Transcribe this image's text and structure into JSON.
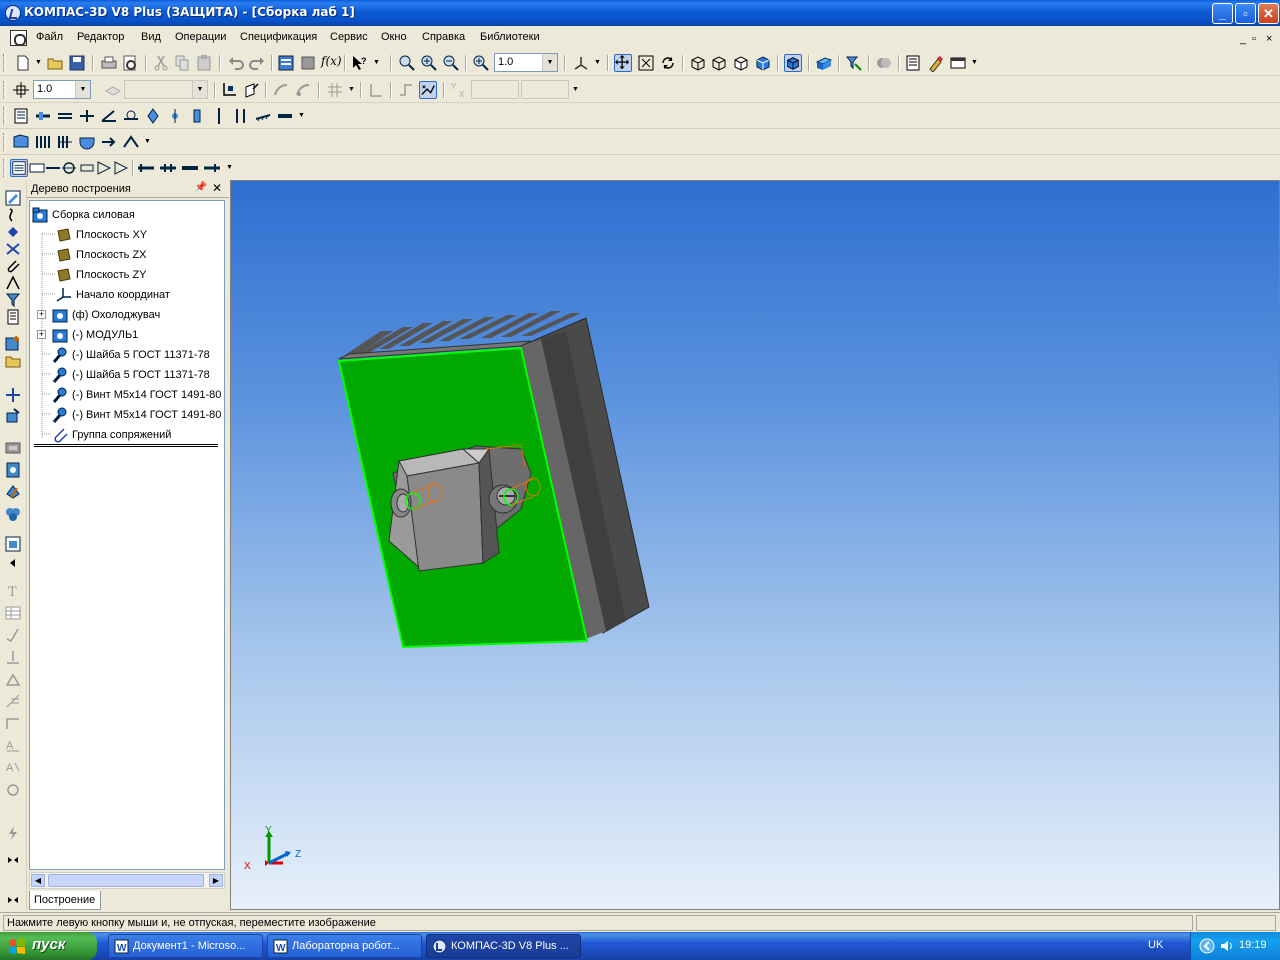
{
  "window": {
    "title": "КОМПАС-3D V8 Plus (ЗАЩИТА) - [Сборка лаб 1]",
    "buttons": {
      "minimize": "_",
      "maximize": "▫",
      "close": "✕"
    }
  },
  "menu": {
    "items": [
      "Файл",
      "Редактор",
      "Вид",
      "Операции",
      "Спецификация",
      "Сервис",
      "Окно",
      "Справка",
      "Библиотеки"
    ],
    "mdi_controls": [
      "_",
      "▫",
      "×"
    ]
  },
  "toolbar": {
    "zoom_value": "1.0",
    "step_value": "1.0",
    "fx_label": "f(x)"
  },
  "tree_panel": {
    "title": "Дерево построения",
    "pin_icon": "pin-icon",
    "close_label": "✕",
    "items": [
      {
        "label": "Сборка силовая",
        "icon": "assembly-icon",
        "level": 0
      },
      {
        "label": "Плоскость XY",
        "icon": "plane-icon",
        "level": 1
      },
      {
        "label": "Плоскость ZX",
        "icon": "plane-icon",
        "level": 1
      },
      {
        "label": "Плоскость ZY",
        "icon": "plane-icon",
        "level": 1
      },
      {
        "label": "Начало координат",
        "icon": "origin-icon",
        "level": 1
      },
      {
        "label": "(ф) Охолоджувач",
        "icon": "part-icon",
        "level": 1,
        "expandable": true
      },
      {
        "label": "(-) МОДУЛЬ1",
        "icon": "part-icon",
        "level": 1,
        "expandable": true
      },
      {
        "label": "(-) Шайба 5 ГОСТ 11371-78",
        "icon": "standard-part-icon",
        "level": 1
      },
      {
        "label": "(-) Шайба 5 ГОСТ 11371-78",
        "icon": "standard-part-icon",
        "level": 1
      },
      {
        "label": "(-) Винт М5х14 ГОСТ 1491-80",
        "icon": "standard-part-icon",
        "level": 1
      },
      {
        "label": "(-) Винт М5х14 ГОСТ 1491-80",
        "icon": "standard-part-icon",
        "level": 1
      },
      {
        "label": "Группа сопряжений",
        "icon": "mates-icon",
        "level": 1
      }
    ],
    "tab_label": "Построение"
  },
  "viewport": {
    "axes": {
      "x": "X",
      "y": "Y",
      "z": "Z"
    },
    "colors": {
      "face": "#00a800",
      "edge": "#00ff00",
      "metal": "#888888"
    }
  },
  "status": {
    "hint": "Нажмите левую кнопку мыши и, не отпуская, переместите изображение"
  },
  "taskbar": {
    "start_label": "пуск",
    "tasks": [
      {
        "label": "Документ1 - Microso...",
        "icon": "word-icon"
      },
      {
        "label": "Лабораторна  робот...",
        "icon": "word-icon"
      },
      {
        "label": "КОМПАС-3D V8 Plus ...",
        "icon": "kompas-icon",
        "active": true
      }
    ],
    "language": "UK",
    "clock": "19:19"
  }
}
